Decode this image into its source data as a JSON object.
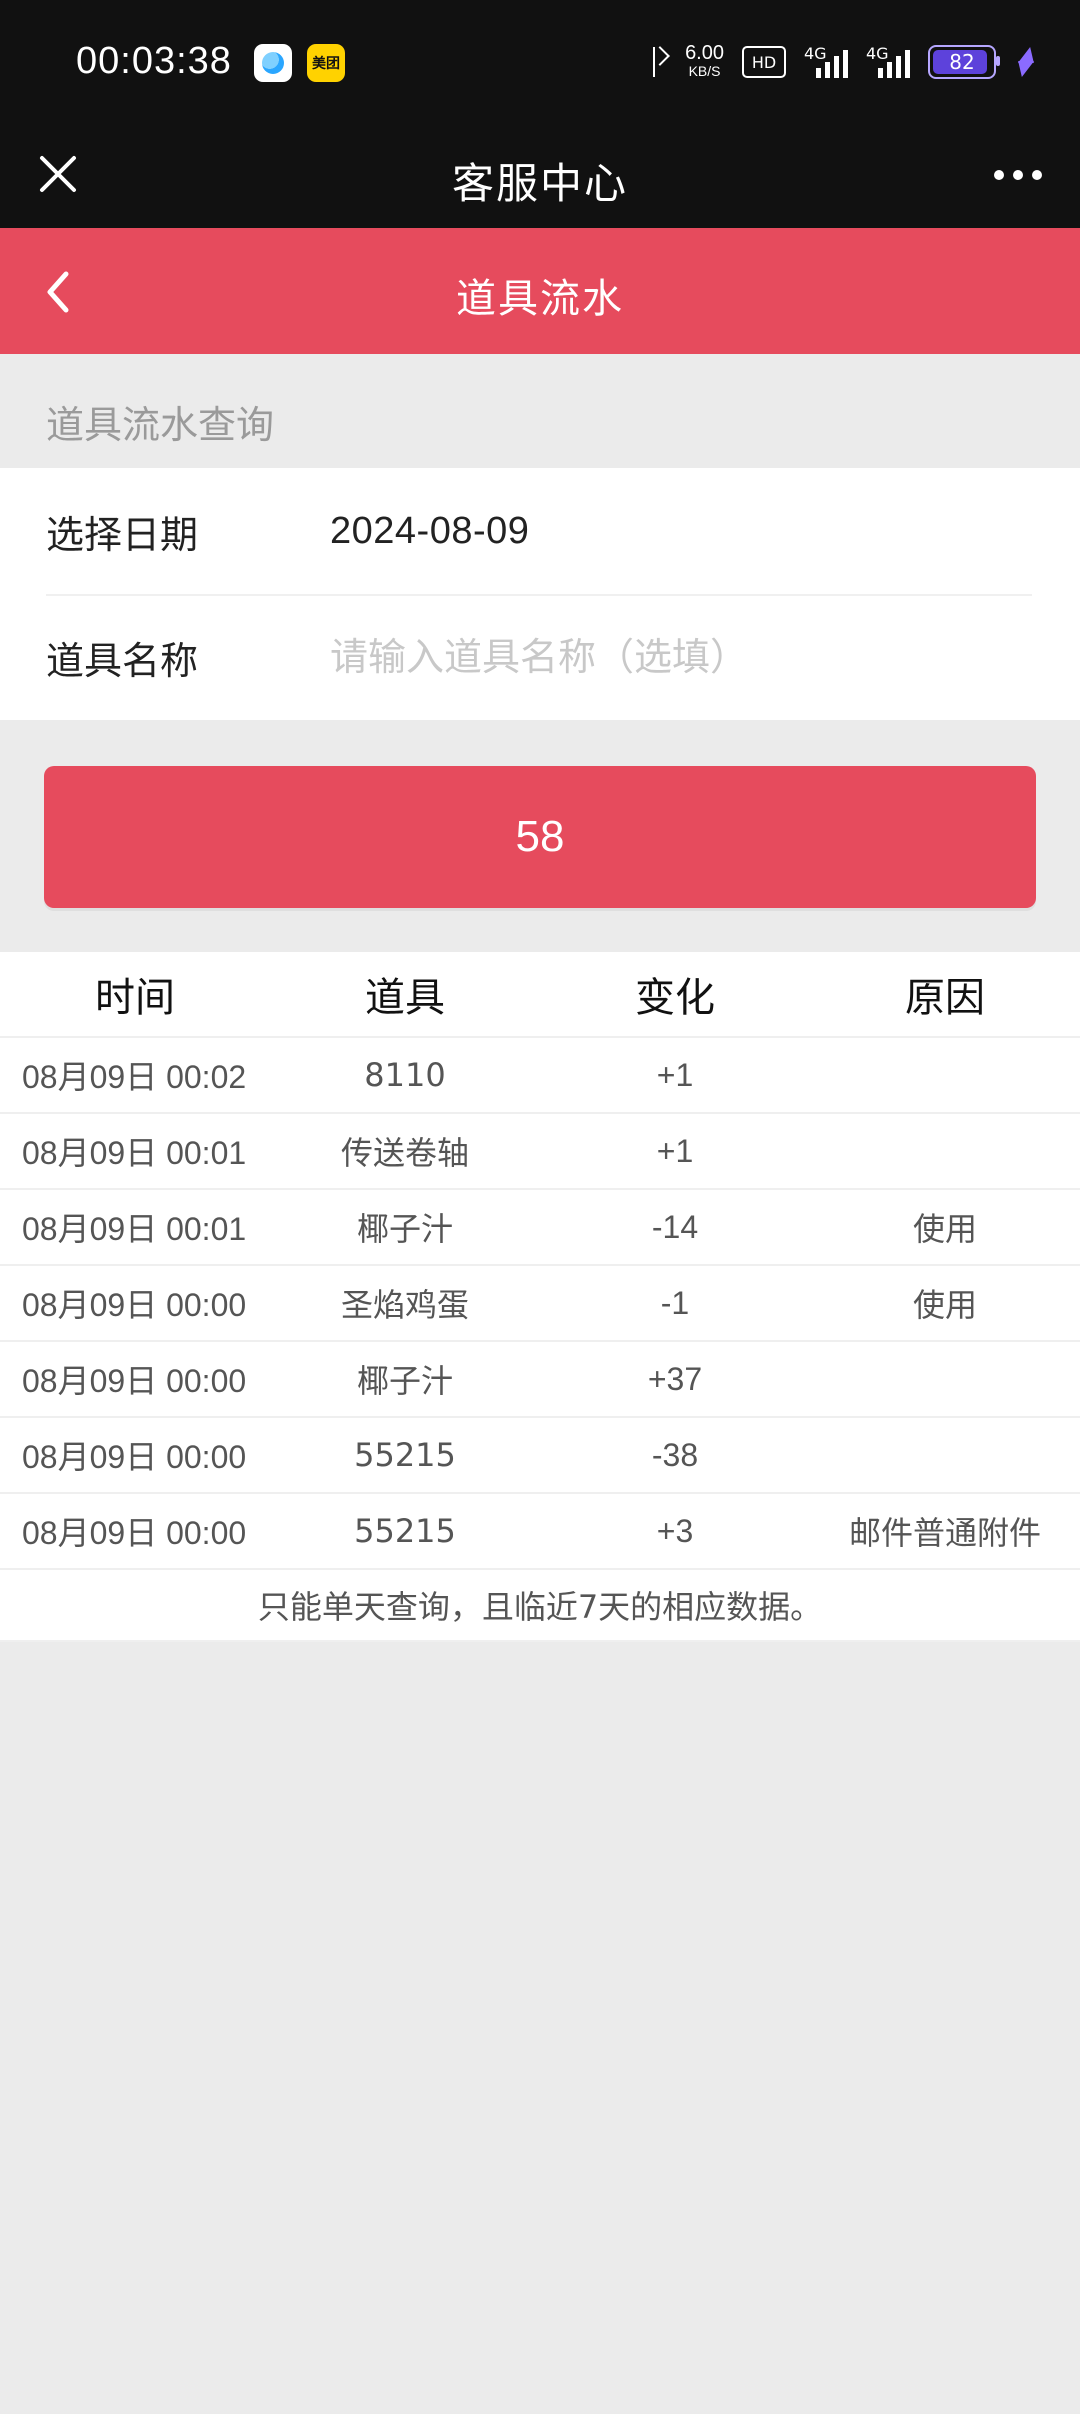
{
  "status_bar": {
    "time": "00:03:38",
    "apps": [
      "QQ",
      "美团"
    ],
    "network_speed_value": "6.00",
    "network_speed_unit": "KB/S",
    "hd_label": "HD",
    "signal1_label": "4G",
    "signal2_label": "4G",
    "battery_percent": "82"
  },
  "app_header": {
    "title": "客服中心",
    "close_icon": "close-icon",
    "more_icon": "more-horizontal-icon"
  },
  "sub_header": {
    "title": "道具流水",
    "back_icon": "chevron-left-icon"
  },
  "query": {
    "section_label": "道具流水查询",
    "date_label": "选择日期",
    "date_value": "2024-08-09",
    "item_name_label": "道具名称",
    "item_name_placeholder": "请输入道具名称（选填）",
    "button_label": "58"
  },
  "table": {
    "headers": [
      "时间",
      "道具",
      "变化",
      "原因"
    ],
    "rows": [
      [
        "08月09日 00:02",
        "8110",
        "+1",
        ""
      ],
      [
        "08月09日 00:01",
        "传送卷轴",
        "+1",
        ""
      ],
      [
        "08月09日 00:01",
        "椰子汁",
        "-14",
        "使用"
      ],
      [
        "08月09日 00:00",
        "圣焰鸡蛋",
        "-1",
        "使用"
      ],
      [
        "08月09日 00:00",
        "椰子汁",
        "+37",
        ""
      ],
      [
        "08月09日 00:00",
        "55215",
        "-38",
        ""
      ],
      [
        "08月09日 00:00",
        "55215",
        "+3",
        "邮件普通附件"
      ]
    ],
    "note": "只能单天查询，且临近7天的相应数据。"
  },
  "colors": {
    "accent_red": "#e64b5d",
    "header_black": "#111111",
    "background": "#ebebeb"
  }
}
